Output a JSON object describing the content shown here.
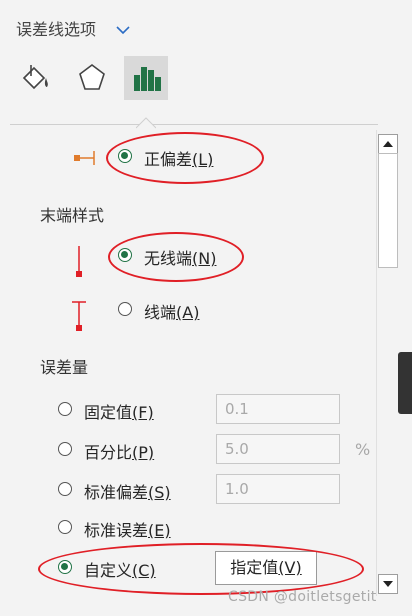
{
  "panel": {
    "title": "误差线选项"
  },
  "tabs": [
    {
      "name": "fill-line"
    },
    {
      "name": "effects"
    },
    {
      "name": "error-bar-options",
      "selected": true
    }
  ],
  "direction": {
    "option_label": "正偏差",
    "option_key": "(L)",
    "selected": true
  },
  "end_style": {
    "heading": "末端样式",
    "options": [
      {
        "label": "无线端",
        "key": "(N)",
        "selected": true
      },
      {
        "label": "线端",
        "key": "(A)",
        "selected": false
      }
    ]
  },
  "error_amount": {
    "heading": "误差量",
    "options": [
      {
        "label": "固定值",
        "key": "(F)",
        "value": "0.1",
        "selected": false
      },
      {
        "label": "百分比",
        "key": "(P)",
        "value": "5.0",
        "unit": "%",
        "selected": false
      },
      {
        "label": "标准偏差",
        "key": "(S)",
        "value": "1.0",
        "selected": false
      },
      {
        "label": "标准误差",
        "key": "(E)",
        "selected": false
      },
      {
        "label": "自定义",
        "key": "(C)",
        "selected": true
      }
    ],
    "specify_button": {
      "label": "指定值",
      "key": "(V)"
    }
  },
  "watermark": "CSDN @doitletsgetit",
  "colors": {
    "accent": "#217346",
    "highlight": "#e01f26",
    "icon_orange": "#e07b2c"
  }
}
